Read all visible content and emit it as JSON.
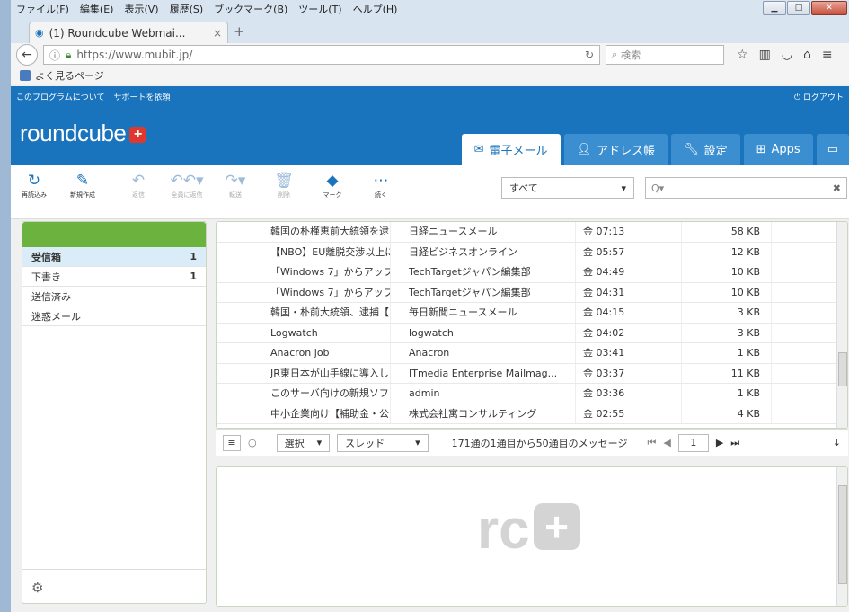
{
  "browser": {
    "menu": [
      "ファイル(F)",
      "編集(E)",
      "表示(V)",
      "履歴(S)",
      "ブックマーク(B)",
      "ツール(T)",
      "ヘルプ(H)"
    ],
    "tab_title": "(1) Roundcube Webmai...",
    "tab_close": "×",
    "new_tab": "+",
    "url": "https://www.mubit.jp/",
    "search_placeholder": "検索",
    "bookmark": "よく見るページ"
  },
  "rc": {
    "top_links": [
      "このプログラムについて",
      "サポートを依頼"
    ],
    "logout": "ログアウト",
    "logo": "roundcube",
    "tasks": [
      "電子メール",
      "アドレス帳",
      "設定",
      "Apps"
    ],
    "toolbar": [
      "再読込み",
      "新規作成",
      "返信",
      "全員に返信",
      "転送",
      "削除",
      "マーク",
      "続く"
    ],
    "filter": "すべて",
    "search_placeholder": "Q▾",
    "folders": [
      {
        "name": "受信箱",
        "count": "1"
      },
      {
        "name": "下書き",
        "count": "1"
      },
      {
        "name": "送信済み",
        "count": ""
      },
      {
        "name": "迷惑メール",
        "count": ""
      }
    ],
    "messages": [
      {
        "subject": "韓国の朴槿恵前大統領を逮...",
        "from": "日経ニュースメール",
        "date": "金 07:13",
        "size": "58 KB"
      },
      {
        "subject": "【NBO】EU離脱交渉以上に...",
        "from": "日経ビジネスオンライン",
        "date": "金 05:57",
        "size": "12 KB"
      },
      {
        "subject": "「Windows 7」からアップ...",
        "from": "TechTargetジャパン編集部",
        "date": "金 04:49",
        "size": "10 KB"
      },
      {
        "subject": "「Windows 7」からアップ...",
        "from": "TechTargetジャパン編集部",
        "date": "金 04:31",
        "size": "10 KB"
      },
      {
        "subject": "韓国・朴前大統領、逮捕【3...",
        "from": "毎日新聞ニュースメール",
        "date": "金 04:15",
        "size": "3 KB"
      },
      {
        "subject": "Logwatch",
        "from": "logwatch",
        "date": "金 04:02",
        "size": "3 KB"
      },
      {
        "subject": "Anacron job",
        "from": "Anacron",
        "date": "金 03:41",
        "size": "1 KB"
      },
      {
        "subject": "JR東日本が山手線に導入し...",
        "from": "ITmedia Enterprise Mailmag...",
        "date": "金 03:37",
        "size": "11 KB"
      },
      {
        "subject": "このサーバ向けの新規ソフ...",
        "from": "admin",
        "date": "金 03:36",
        "size": "1 KB"
      },
      {
        "subject": "中小企業向け【補助金・公...",
        "from": "株式会社寓コンサルティング",
        "date": "金 02:55",
        "size": "4 KB"
      }
    ],
    "list_footer": {
      "select": "選択",
      "thread": "スレッド",
      "count": "171通の1通目から50通目のメッセージ",
      "page": "1"
    },
    "watermark": "rc"
  }
}
